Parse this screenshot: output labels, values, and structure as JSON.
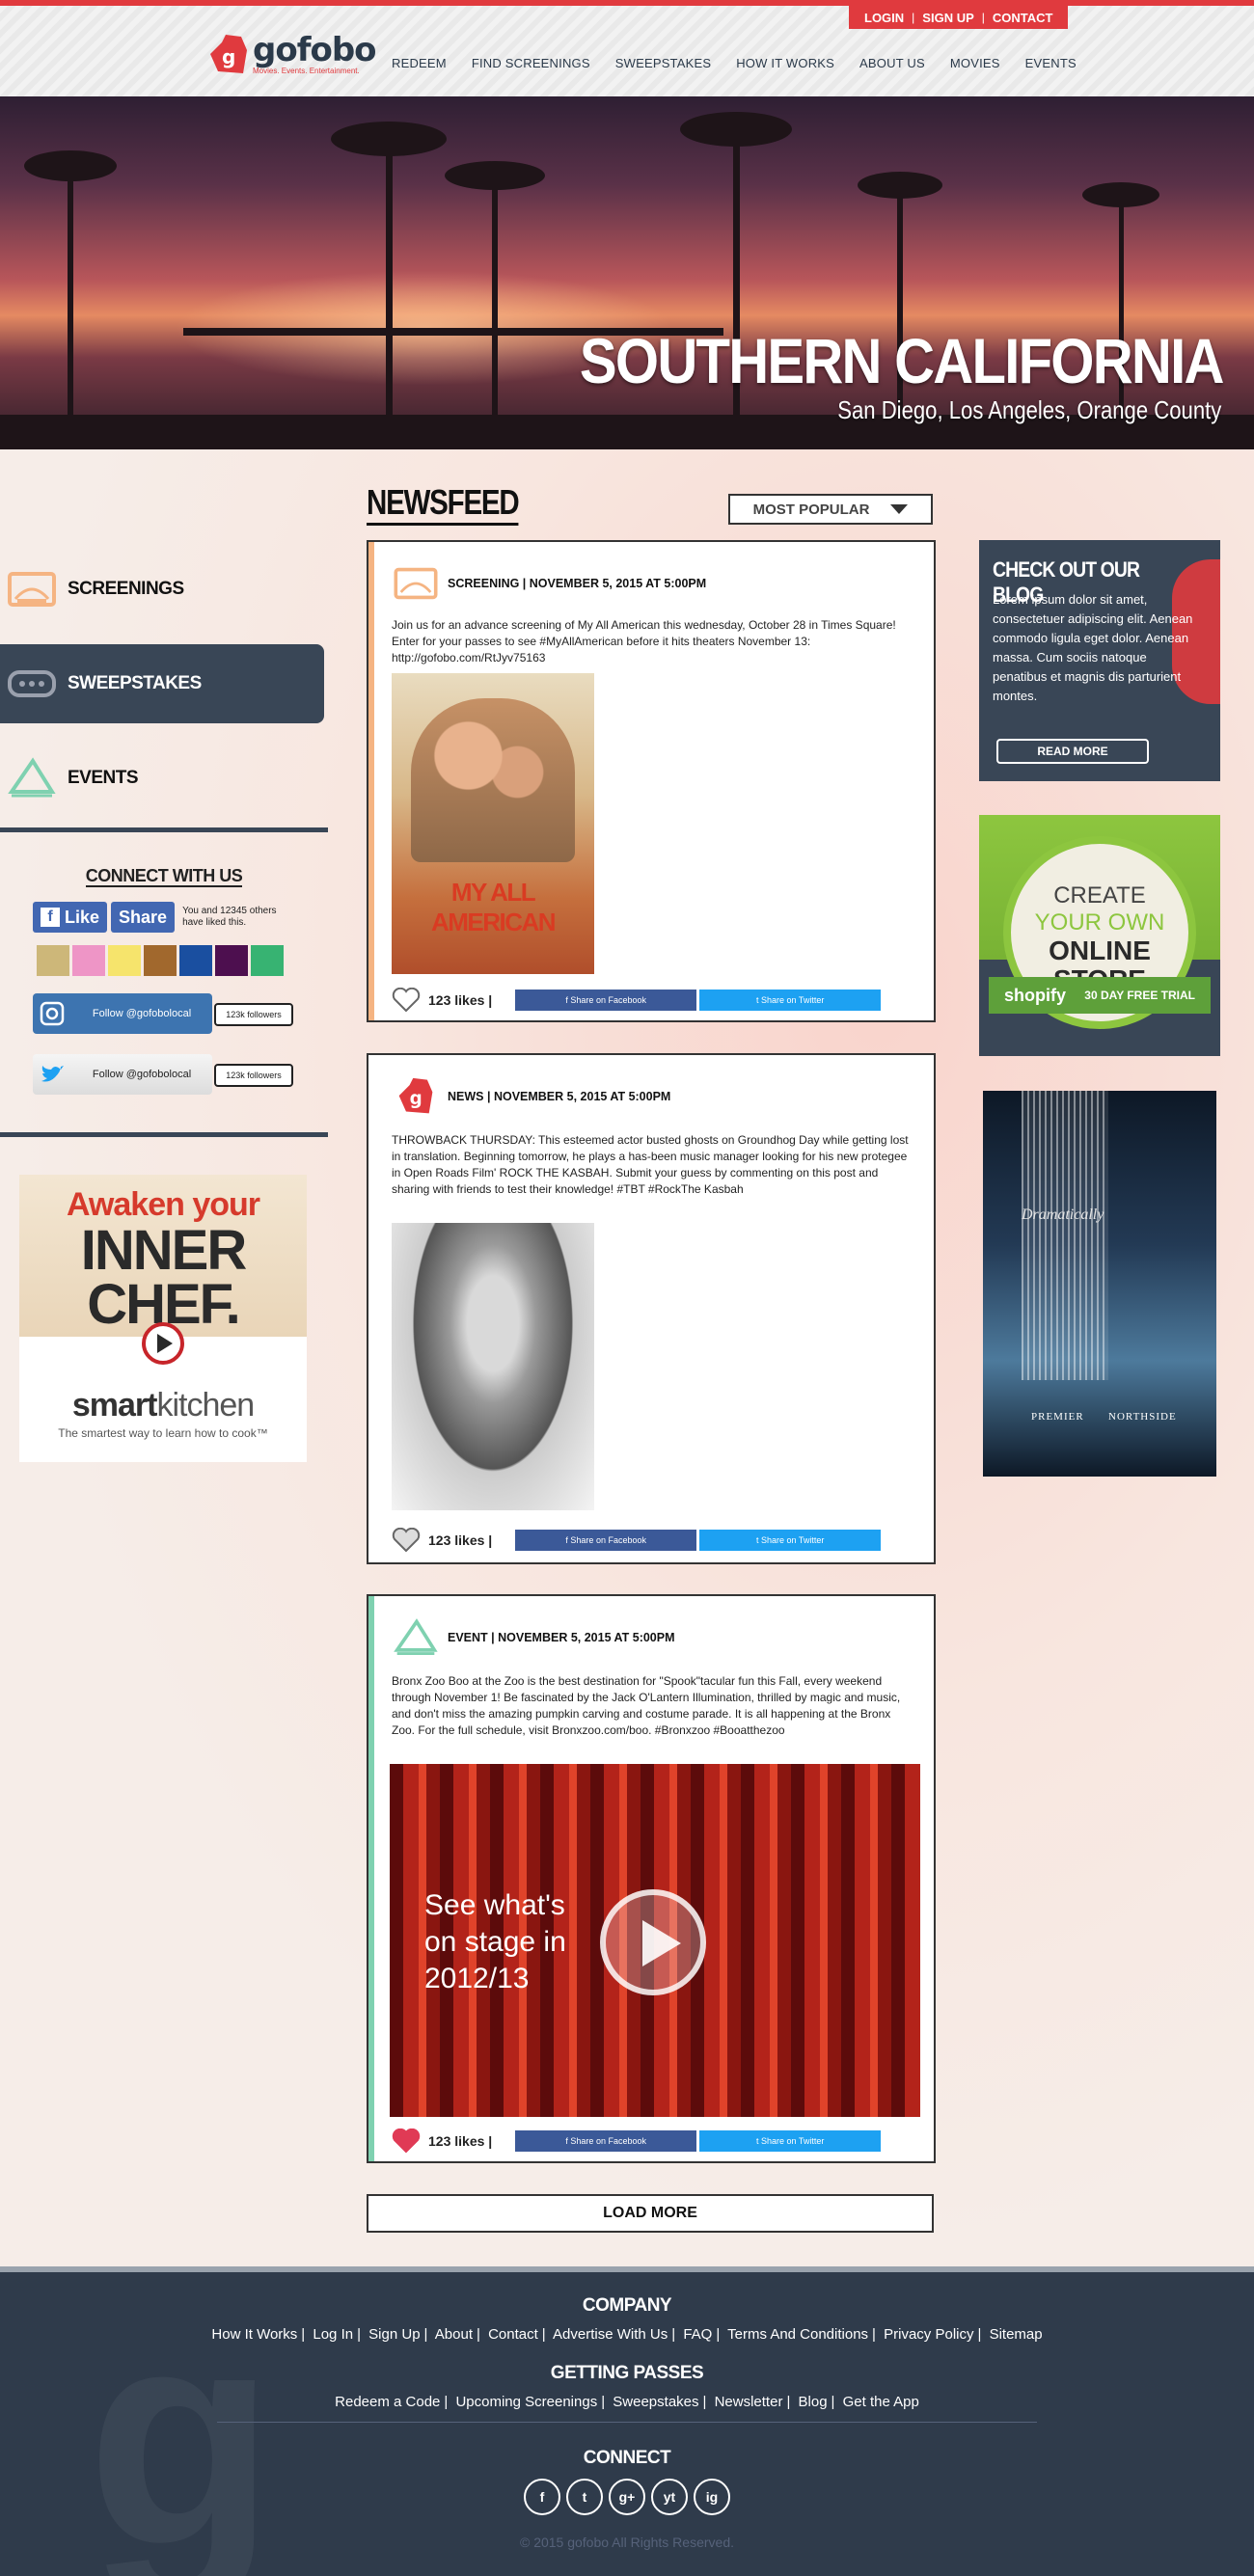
{
  "colors": {
    "brand_red": "#e03a3e",
    "navy": "#394656",
    "facebook": "#3b5998",
    "twitter": "#1da1f2",
    "events_teal": "#7fd1b0",
    "screening_orange": "#f5b482"
  },
  "account": {
    "login": "LOGIN",
    "signup": "SIGN UP",
    "contact": "CONTACT",
    "sep": "|"
  },
  "logo": {
    "text": "gofobo",
    "tagline": "Movies. Events. Entertainment.",
    "mark": "g"
  },
  "nav": [
    "REDEEM",
    "FIND SCREENINGS",
    "SWEEPSTAKES",
    "HOW IT WORKS",
    "ABOUT US",
    "MOVIES",
    "EVENTS"
  ],
  "hero": {
    "title": "SOUTHERN CALIFORNIA",
    "subtitle": "San Diego, Los Angeles, Orange County"
  },
  "sidebar": {
    "items": [
      {
        "label": "SCREENINGS",
        "icon": "screening-icon"
      },
      {
        "label": "SWEEPSTAKES",
        "icon": "ticket-icon",
        "active": true
      },
      {
        "label": "EVENTS",
        "icon": "megaphone-icon"
      }
    ],
    "connect_title": "CONNECT WITH US",
    "fb_like": "Like",
    "fb_share": "Share",
    "fb_text": "You and 12345 others have liked this.",
    "swatches": [
      "#cdb779",
      "#ee95c6",
      "#f6e46c",
      "#a1682d",
      "#1a4fa0",
      "#4d0f4f",
      "#37b372"
    ],
    "instagram": {
      "label": "Follow @gofobolocal",
      "count": "123k followers"
    },
    "twitter": {
      "label": "Follow @gofobolocal",
      "count": "123k followers"
    }
  },
  "leftad": {
    "line1": "Awaken your",
    "line2": "INNER",
    "line3": "CHEF.",
    "brand_a": "smart",
    "brand_b": "kitchen",
    "tagline": "The smartest way to learn how to cook™"
  },
  "newsfeed": {
    "title": "NEWSFEED",
    "sort": "MOST POPULAR",
    "load_more": "LOAD MORE",
    "likes_label": "123 likes |",
    "share_fb": "f  Share on Facebook",
    "share_tw": "t  Share on Twitter",
    "posts": [
      {
        "type": "screening",
        "meta": "SCREENING | NOVEMBER 5, 2015 AT 5:00PM",
        "body": "Join us for an advance screening of My All American this wednesday, October 28 in Times Square! Enter for your passes to see #MyAllAmerican before it hits theaters November 13: http://gofobo.com/RtJyv75163",
        "poster_title": "MY ALL AMERICAN"
      },
      {
        "type": "news",
        "meta": "NEWS | NOVEMBER 5, 2015 AT 5:00PM",
        "body": "THROWBACK THURSDAY: This esteemed actor busted ghosts on Groundhog Day while getting lost in translation. Beginning tomorrow, he plays a has-been music manager looking for his new protegee in Open Roads Film' ROCK THE KASBAH. Submit your guess by commenting on this post and sharing with friends to test their knowledge! #TBT #RockThe Kasbah"
      },
      {
        "type": "event",
        "meta": "EVENT | NOVEMBER 5, 2015 AT 5:00PM",
        "body": "Bronx Zoo Boo at the Zoo is the best destination for \"Spook\"tacular fun this Fall, every weekend through November 1! Be fascinated by the Jack O'Lantern Illumination, thrilled by magic and music, and don't miss the amazing pumpkin carving and costume parade. It is all happening at the Bronx Zoo. For the full schedule, visit Bronxzoo.com/boo. #Bronxzoo #Booatthezoo",
        "video_text": "See what's on stage in 2012/13"
      }
    ]
  },
  "blog": {
    "title": "CHECK OUT OUR BLOG",
    "text": "Lorem ipsum dolor sit amet, consectetuer adipiscing elit. Aenean commodo ligula eget dolor. Aenean massa. Cum sociis natoque penatibus et magnis dis parturient montes.",
    "button": "READ MORE"
  },
  "shopify": {
    "l1": "CREATE",
    "l2": "YOUR OWN",
    "l3": "ONLINE",
    "l4": "STORE",
    "brand": "shopify",
    "trial": "30 DAY FREE TRIAL"
  },
  "falls": {
    "script": "Dramatically",
    "brand1": "PREMIER",
    "brand2": "NORTHSIDE"
  },
  "footer": {
    "company_title": "COMPANY",
    "company_links": [
      "How It Works",
      "Log In",
      "Sign Up",
      "About",
      "Contact",
      "Advertise With Us",
      "FAQ",
      "Terms And Conditions",
      "Privacy Policy",
      "Sitemap"
    ],
    "passes_title": "GETTING PASSES",
    "passes_links": [
      "Redeem a Code",
      "Upcoming Screenings",
      "Sweepstakes",
      "Newsletter",
      "Blog",
      "Get the App"
    ],
    "connect_title": "CONNECT",
    "socials": [
      "f",
      "t",
      "g+",
      "yt",
      "ig"
    ],
    "copyright": "© 2015 gofobo All Rights Reserved."
  }
}
